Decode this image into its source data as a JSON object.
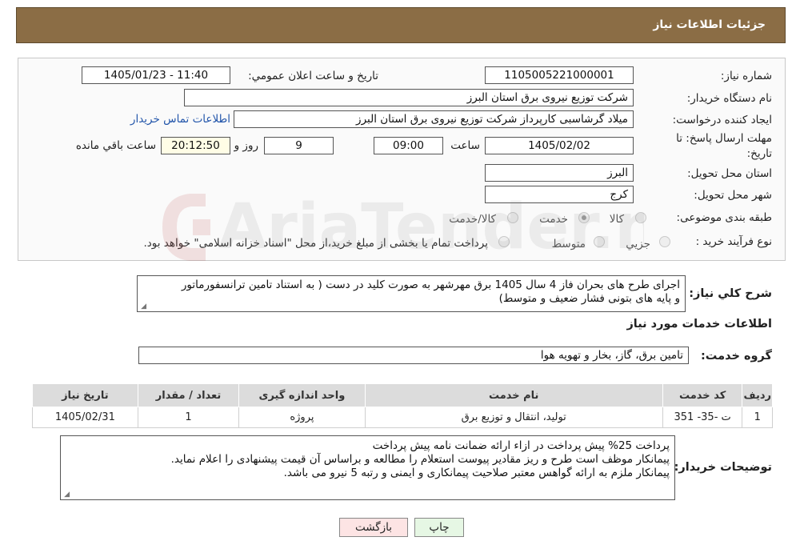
{
  "header": {
    "title": "جزئیات اطلاعات نیاز"
  },
  "fields": {
    "need_number_label": "شماره نیاز:",
    "need_number": "1105005221000001",
    "announce_label": "تاریخ و ساعت اعلان عمومي:",
    "announce_value": "1405/01/23 - 11:40",
    "buyer_org_label": "نام دستگاه خریدار:",
    "buyer_org": "شرکت توزیع نیروی برق استان البرز",
    "requester_label": "ایجاد کننده درخواست:",
    "requester": "میلاد گرشاسبی کارپرداز شرکت توزیع نیروی برق استان البرز",
    "contact_link": "اطلاعات تماس خریدار",
    "deadline_label_1": "مهلت ارسال پاسخ: تا",
    "deadline_label_2": "تاریخ:",
    "deadline_date": "1405/02/02",
    "time_label": "ساعت",
    "deadline_time": "09:00",
    "days_value": "9",
    "days_label": "روز و",
    "remaining_time": "20:12:50",
    "remaining_label": "ساعت باقي مانده",
    "province_label": "استان محل تحویل:",
    "province": "البرز",
    "city_label": "شهر محل تحویل:",
    "city": "کرج",
    "category_label": "طبقه بندی موضوعی:",
    "category_options": [
      "کالا",
      "خدمت",
      "کالا/خدمت"
    ],
    "purchase_type_label": "نوع فرآیند خرید :",
    "purchase_options": [
      "جزیي",
      "متوسط"
    ],
    "purchase_note": "پرداخت تمام یا بخشی از مبلغ خرید،از محل \"اسناد خزانه اسلامی\" خواهد بود."
  },
  "summary": {
    "label": "شرح کلي نیاز:",
    "line1": "اجرای طرح های بحران فاز 4 سال 1405 برق مهرشهر به صورت کلید در دست ( به استناد تامین ترانسفورماتور",
    "line2": "و پایه های بتونی فشار ضعیف و متوسط)"
  },
  "services_section": {
    "title": "اطلاعات خدمات مورد نیاز",
    "group_label": "گروه خدمت:",
    "group_value": "تامین برق، گاز، بخار و تهویه هوا"
  },
  "table": {
    "headers": [
      "ردیف",
      "کد خدمت",
      "نام خدمت",
      "واحد اندازه گیری",
      "تعداد / مقدار",
      "تاریخ نیاز"
    ],
    "rows": [
      [
        "1",
        "ت -35- 351",
        "تولید، انتقال و توزیع برق",
        "پروژه",
        "1",
        "1405/02/31"
      ]
    ]
  },
  "buyer_notes": {
    "label": "توضیحات خریدار:",
    "line1": "پرداخت 25% پیش پرداخت در ازاء ارائه ضمانت نامه پیش پرداخت",
    "line2": "پیمانکار موظف است طرح و ریز مقادیر پیوست استعلام را مطالعه و براساس آن قیمت پیشنهادی را اعلام نماید.",
    "line3": "پیمانکار ملزم به ارائه گواهس معتبر صلاحیت پیمانکاری و ایمنی و رتبه 5 نیرو می باشد."
  },
  "buttons": {
    "print": "چاپ",
    "back": "بازگشت"
  },
  "watermark": {
    "text": "AriaTender.neT"
  },
  "colors": {
    "header_bg": "#8b6d45",
    "back_bg": "#fde4e4",
    "print_bg": "#e6f7e4",
    "link": "#2255aa"
  }
}
